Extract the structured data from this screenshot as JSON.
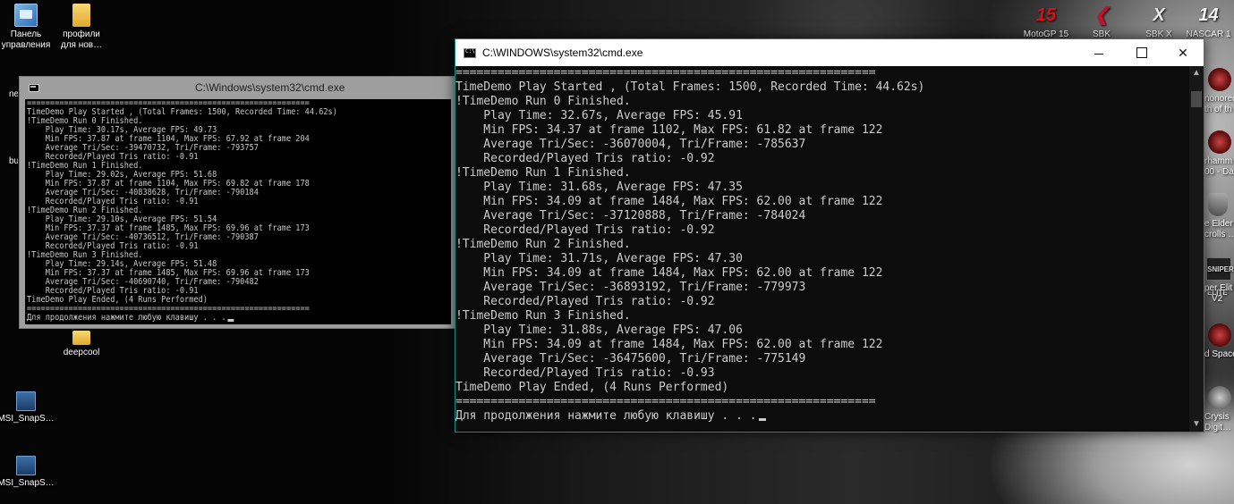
{
  "desktop": {
    "left_icons": [
      {
        "label": "Панель управления",
        "icon": "control-panel-icon"
      },
      {
        "label": "профили для нов…",
        "icon": "folder-icon"
      },
      {
        "label": "deepcool",
        "icon": "folder-icon"
      },
      {
        "label": "MSI_SnapS…",
        "icon": "app-icon"
      },
      {
        "label": "MSI_SnapS…",
        "icon": "app-icon"
      }
    ],
    "partial_left": [
      "ne",
      "bu"
    ],
    "top_right_icons": [
      {
        "label": "MotoGP 15",
        "glyph": "15",
        "icon": "motogp-icon",
        "color": "#d9101a"
      },
      {
        "label": "SBK",
        "glyph": "❮",
        "icon": "sbk-icon",
        "color": "#c8102e"
      },
      {
        "label": "SBK X",
        "glyph": "X",
        "icon": "sbk-x-icon",
        "color": "#e6e6e6"
      },
      {
        "label": "NASCAR 1",
        "glyph": "14",
        "icon": "nascar-icon",
        "color": "#f2f2f2"
      }
    ],
    "right_edge_icons": [
      {
        "lines": [
          "nonored",
          "th of th"
        ],
        "icon": "game-icon"
      },
      {
        "lines": [
          "rhamm",
          "00 - Da"
        ],
        "icon": "warhammer-icon"
      },
      {
        "lines": [
          "e Elder",
          "crolls …"
        ],
        "icon": "skyrim-icon"
      },
      {
        "lines": [
          "per Elit",
          "V2"
        ],
        "icon": "sniper-elite-icon",
        "badge": "SNIPER ELITE"
      },
      {
        "lines": [
          "d Space"
        ],
        "icon": "dead-space-icon"
      },
      {
        "lines": [
          "Crysis",
          "Digit…"
        ],
        "icon": "crysis-icon"
      }
    ]
  },
  "back_window": {
    "title": "C:\\Windows\\system32\\cmd.exe",
    "lines": [
      "=============================================================",
      "TimeDemo Play Started , (Total Frames: 1500, Recorded Time: 44.62s)",
      "!TimeDemo Run 0 Finished.",
      "    Play Time: 30.17s, Average FPS: 49.73",
      "    Min FPS: 37.87 at frame 1104, Max FPS: 67.92 at frame 204",
      "    Average Tri/Sec: -39470732, Tri/Frame: -793757",
      "    Recorded/Played Tris ratio: -0.91",
      "!TimeDemo Run 1 Finished.",
      "    Play Time: 29.02s, Average FPS: 51.68",
      "    Min FPS: 37.87 at frame 1104, Max FPS: 69.82 at frame 178",
      "    Average Tri/Sec: -40838628, Tri/Frame: -790184",
      "    Recorded/Played Tris ratio: -0.91",
      "!TimeDemo Run 2 Finished.",
      "    Play Time: 29.10s, Average FPS: 51.54",
      "    Min FPS: 37.37 at frame 1485, Max FPS: 69.96 at frame 173",
      "    Average Tri/Sec: -40736512, Tri/Frame: -790387",
      "    Recorded/Played Tris ratio: -0.91",
      "!TimeDemo Run 3 Finished.",
      "    Play Time: 29.14s, Average FPS: 51.48",
      "    Min FPS: 37.37 at frame 1485, Max FPS: 69.96 at frame 173",
      "    Average Tri/Sec: -40690740, Tri/Frame: -790482",
      "    Recorded/Played Tris ratio: -0.91",
      "TimeDemo Play Ended, (4 Runs Performed)",
      "=============================================================",
      "Для продолжения нажмите любую клавишу . . ."
    ]
  },
  "front_window": {
    "title": "C:\\WINDOWS\\system32\\cmd.exe",
    "controls": {
      "minimize": "minimize",
      "maximize": "maximize",
      "close": "✕"
    },
    "lines": [
      "============================================================",
      "TimeDemo Play Started , (Total Frames: 1500, Recorded Time: 44.62s)",
      "!TimeDemo Run 0 Finished.",
      "    Play Time: 32.67s, Average FPS: 45.91",
      "    Min FPS: 34.37 at frame 1102, Max FPS: 61.82 at frame 122",
      "    Average Tri/Sec: -36070004, Tri/Frame: -785637",
      "    Recorded/Played Tris ratio: -0.92",
      "!TimeDemo Run 1 Finished.",
      "    Play Time: 31.68s, Average FPS: 47.35",
      "    Min FPS: 34.09 at frame 1484, Max FPS: 62.00 at frame 122",
      "    Average Tri/Sec: -37120888, Tri/Frame: -784024",
      "    Recorded/Played Tris ratio: -0.92",
      "!TimeDemo Run 2 Finished.",
      "    Play Time: 31.71s, Average FPS: 47.30",
      "    Min FPS: 34.09 at frame 1484, Max FPS: 62.00 at frame 122",
      "    Average Tri/Sec: -36893192, Tri/Frame: -779973",
      "    Recorded/Played Tris ratio: -0.92",
      "!TimeDemo Run 3 Finished.",
      "    Play Time: 31.88s, Average FPS: 47.06",
      "    Min FPS: 34.09 at frame 1484, Max FPS: 62.00 at frame 122",
      "    Average Tri/Sec: -36475600, Tri/Frame: -775149",
      "    Recorded/Played Tris ratio: -0.93",
      "TimeDemo Play Ended, (4 Runs Performed)",
      "============================================================",
      "Для продолжения нажмите любую клавишу . . ."
    ]
  },
  "colors": {
    "accent_border": "#0e8c8c",
    "console_bg": "#0c0c0c",
    "console_text": "#cccccc"
  }
}
